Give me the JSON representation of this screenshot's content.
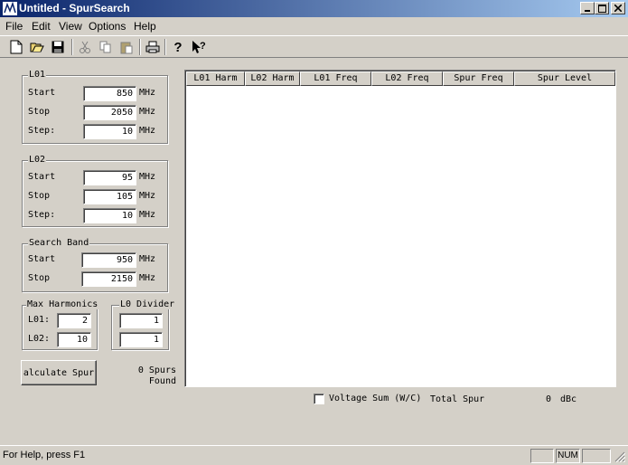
{
  "window": {
    "title": "Untitled - SpurSearch"
  },
  "menu": [
    "File",
    "Edit",
    "View",
    "Options",
    "Help"
  ],
  "toolbar": [
    "new-file-icon",
    "open-folder-icon",
    "save-icon",
    "cut-icon",
    "copy-icon",
    "paste-icon",
    "print-icon",
    "help-icon",
    "context-help-icon"
  ],
  "lo1": {
    "title": "L01",
    "start_label": "Start",
    "start": "850",
    "stop_label": "Stop",
    "stop": "2050",
    "step_label": "Step:",
    "step": "10",
    "unit": "MHz"
  },
  "lo2": {
    "title": "L02",
    "start_label": "Start",
    "start": "95",
    "stop_label": "Stop",
    "stop": "105",
    "step_label": "Step:",
    "step": "10",
    "unit": "MHz"
  },
  "search_band": {
    "title": "Search Band",
    "start_label": "Start",
    "start": "950",
    "stop_label": "Stop",
    "stop": "2150",
    "unit": "MHz"
  },
  "harmonics": {
    "title": "Max Harmonics",
    "lo1_label": "L01:",
    "lo1": "2",
    "lo2_label": "L02:",
    "lo2": "10"
  },
  "divider": {
    "title": "L0 Divider",
    "value1": "1",
    "value2": "1"
  },
  "calc_button": "alculate Spur",
  "spurs_found": {
    "line1": "0 Spurs",
    "line2": "Found"
  },
  "table": {
    "columns": [
      "L01 Harm",
      "L02 Harm",
      "L01 Freq",
      "L02 Freq",
      "Spur Freq",
      "Spur Level"
    ],
    "rows": []
  },
  "voltage_sum": {
    "label": "Voltage Sum (W/C)",
    "checked": false
  },
  "total_spur": {
    "label": "Total Spur",
    "value": "0",
    "unit": "dBc"
  },
  "status": {
    "help": "For Help, press F1",
    "num": "NUM"
  }
}
